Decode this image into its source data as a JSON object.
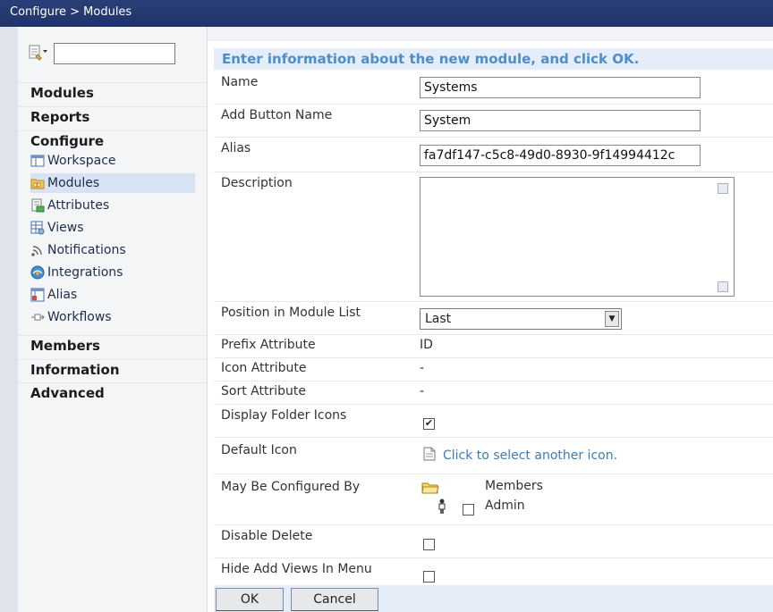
{
  "titlebar": {
    "breadcrumb": "Configure > Modules"
  },
  "sidebar": {
    "search": {
      "value": "",
      "placeholder": ""
    },
    "sections": {
      "modules": "Modules",
      "reports": "Reports",
      "configure": "Configure",
      "members": "Members",
      "information": "Information",
      "advanced": "Advanced"
    },
    "configure_items": [
      {
        "label": "Workspace",
        "icon": "workspace-icon"
      },
      {
        "label": "Modules",
        "icon": "modules-folder-icon",
        "active": true
      },
      {
        "label": "Attributes",
        "icon": "attributes-icon"
      },
      {
        "label": "Views",
        "icon": "views-icon"
      },
      {
        "label": "Notifications",
        "icon": "notifications-icon"
      },
      {
        "label": "Integrations",
        "icon": "integrations-icon"
      },
      {
        "label": "Alias",
        "icon": "alias-icon"
      },
      {
        "label": "Workflows",
        "icon": "workflows-icon"
      }
    ]
  },
  "form": {
    "heading": "Enter information about the new module, and click OK.",
    "name": {
      "label": "Name",
      "value": "Systems"
    },
    "add_button_name": {
      "label": "Add Button Name",
      "value": "System"
    },
    "alias": {
      "label": "Alias",
      "value": "fa7df147-c5c8-49d0-8930-9f14994412c"
    },
    "description": {
      "label": "Description",
      "value": ""
    },
    "position": {
      "label": "Position in Module List",
      "value": "Last"
    },
    "prefix_attribute": {
      "label": "Prefix Attribute",
      "value": "ID"
    },
    "icon_attribute": {
      "label": "Icon Attribute",
      "value": "-"
    },
    "sort_attribute": {
      "label": "Sort Attribute",
      "value": "-"
    },
    "display_folder_icons": {
      "label": "Display Folder Icons",
      "checked": true
    },
    "default_icon": {
      "label": "Default Icon",
      "link": "Click to select another icon."
    },
    "may_be_configured_by": {
      "label": "May Be Configured By",
      "group": "Members",
      "role": "Admin",
      "role_checked": false
    },
    "disable_delete": {
      "label": "Disable Delete",
      "checked": false
    },
    "hide_add_views": {
      "label": "Hide Add Views In Menu",
      "checked": false
    }
  },
  "buttons": {
    "ok": "OK",
    "cancel": "Cancel"
  },
  "colors": {
    "titlebar": "#23376e",
    "heading_text": "#4b8fcb",
    "heading_bg": "#e4edf8",
    "link": "#3c7cb8"
  }
}
